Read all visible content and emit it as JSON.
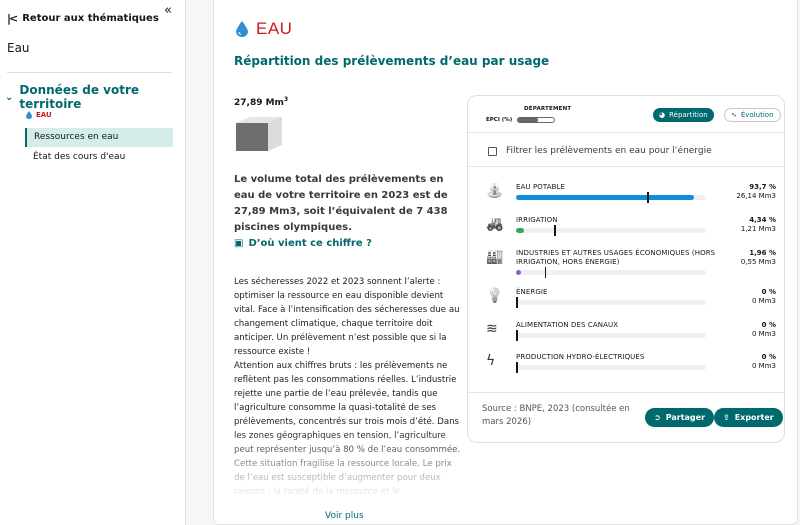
{
  "sidebar": {
    "back_label": "Retour aux thématiques",
    "title": "Eau",
    "territory_label": "Données de votre territoire",
    "tag_label": "EAU",
    "items": [
      {
        "label": "Ressources en eau",
        "active": true
      },
      {
        "label": "État des cours d'eau",
        "active": false
      }
    ]
  },
  "header": {
    "title": "EAU",
    "section_title": "Répartition des prélèvements d’eau par usage"
  },
  "summary": {
    "volume": "27,89 Mm",
    "volume_exp": "3",
    "text": "Le volume total des prélèvements en eau de votre territoire en 2023 est de 27,89 Mm3, soit l’équivalent de 7 438 piscines olympiques.",
    "source_link": "D’où vient ce chiffre ?",
    "body_paragraphs": [
      "Les sécheresses 2022 et 2023 sonnent l’alerte : optimiser la ressource en eau disponible devient vital. Face à l’intensification des sécheresses due au changement climatique, chaque territoire doit anticiper. Un prélèvement n’est possible que si la ressource existe !",
      "Attention aux chiffres bruts : les prélèvements ne reflètent pas les consommations réelles. L’industrie rejette une partie de l’eau prélevée, tandis que l’agriculture consomme la quasi-totalité de ses prélèvements, concentrés sur trois mois d’été. Dans les zones géographiques en tension, l’agriculture peut représenter jusqu’à 80 % de l’eau consommée. Cette situation fragilise la ressource locale. Le prix de l’eau est susceptible d’augmenter pour deux raisons : la rareté de la ressource et le"
    ],
    "more_label": "Voir plus"
  },
  "panel": {
    "dept_label": "DÉPARTEMENT",
    "epci_label": "EPCI (%)",
    "tab_repartition": "Répartition",
    "tab_evolution": "Évolution",
    "filter_label": "Filtrer les prélèvements en eau pour l’énergie",
    "usages": [
      {
        "label": "Eau potable",
        "pct": "93,7 %",
        "volume": "26,14 Mm3",
        "fraction": 0.937,
        "dept_fraction": 0.69,
        "color": "#0f8fd9",
        "icon": "faucet-icon"
      },
      {
        "label": "Irrigation",
        "pct": "4,34 %",
        "volume": "1,21 Mm3",
        "fraction": 0.0434,
        "dept_fraction": 0.2,
        "color": "#3aa655",
        "icon": "tractor-icon"
      },
      {
        "label": "Industries et autres usages économiques (hors irrigation, hors énergie)",
        "pct": "1,96 %",
        "volume": "0,55 Mm3",
        "fraction": 0.0196,
        "dept_fraction": 0.15,
        "color": "#9b59d0",
        "icon": "factory-icon"
      },
      {
        "label": "Énergie",
        "pct": "0 %",
        "volume": "0 Mm3",
        "fraction": 0,
        "dept_fraction": 0,
        "color": "#888888",
        "icon": "bulb-icon"
      },
      {
        "label": "Alimentation des canaux",
        "pct": "0 %",
        "volume": "0 Mm3",
        "fraction": 0,
        "dept_fraction": 0,
        "color": "#888888",
        "icon": "waves-icon"
      },
      {
        "label": "Production hydro-électriques",
        "pct": "0 %",
        "volume": "0 Mm3",
        "fraction": 0,
        "dept_fraction": 0,
        "color": "#888888",
        "icon": "lightning-icon"
      }
    ],
    "source_text": "Source : BNPE, 2023 (consultée en mars 2026)",
    "share_label": "Partager",
    "export_label": "Exporter"
  },
  "colors": {
    "accent": "#00696e",
    "brand_red": "#c9191e"
  }
}
